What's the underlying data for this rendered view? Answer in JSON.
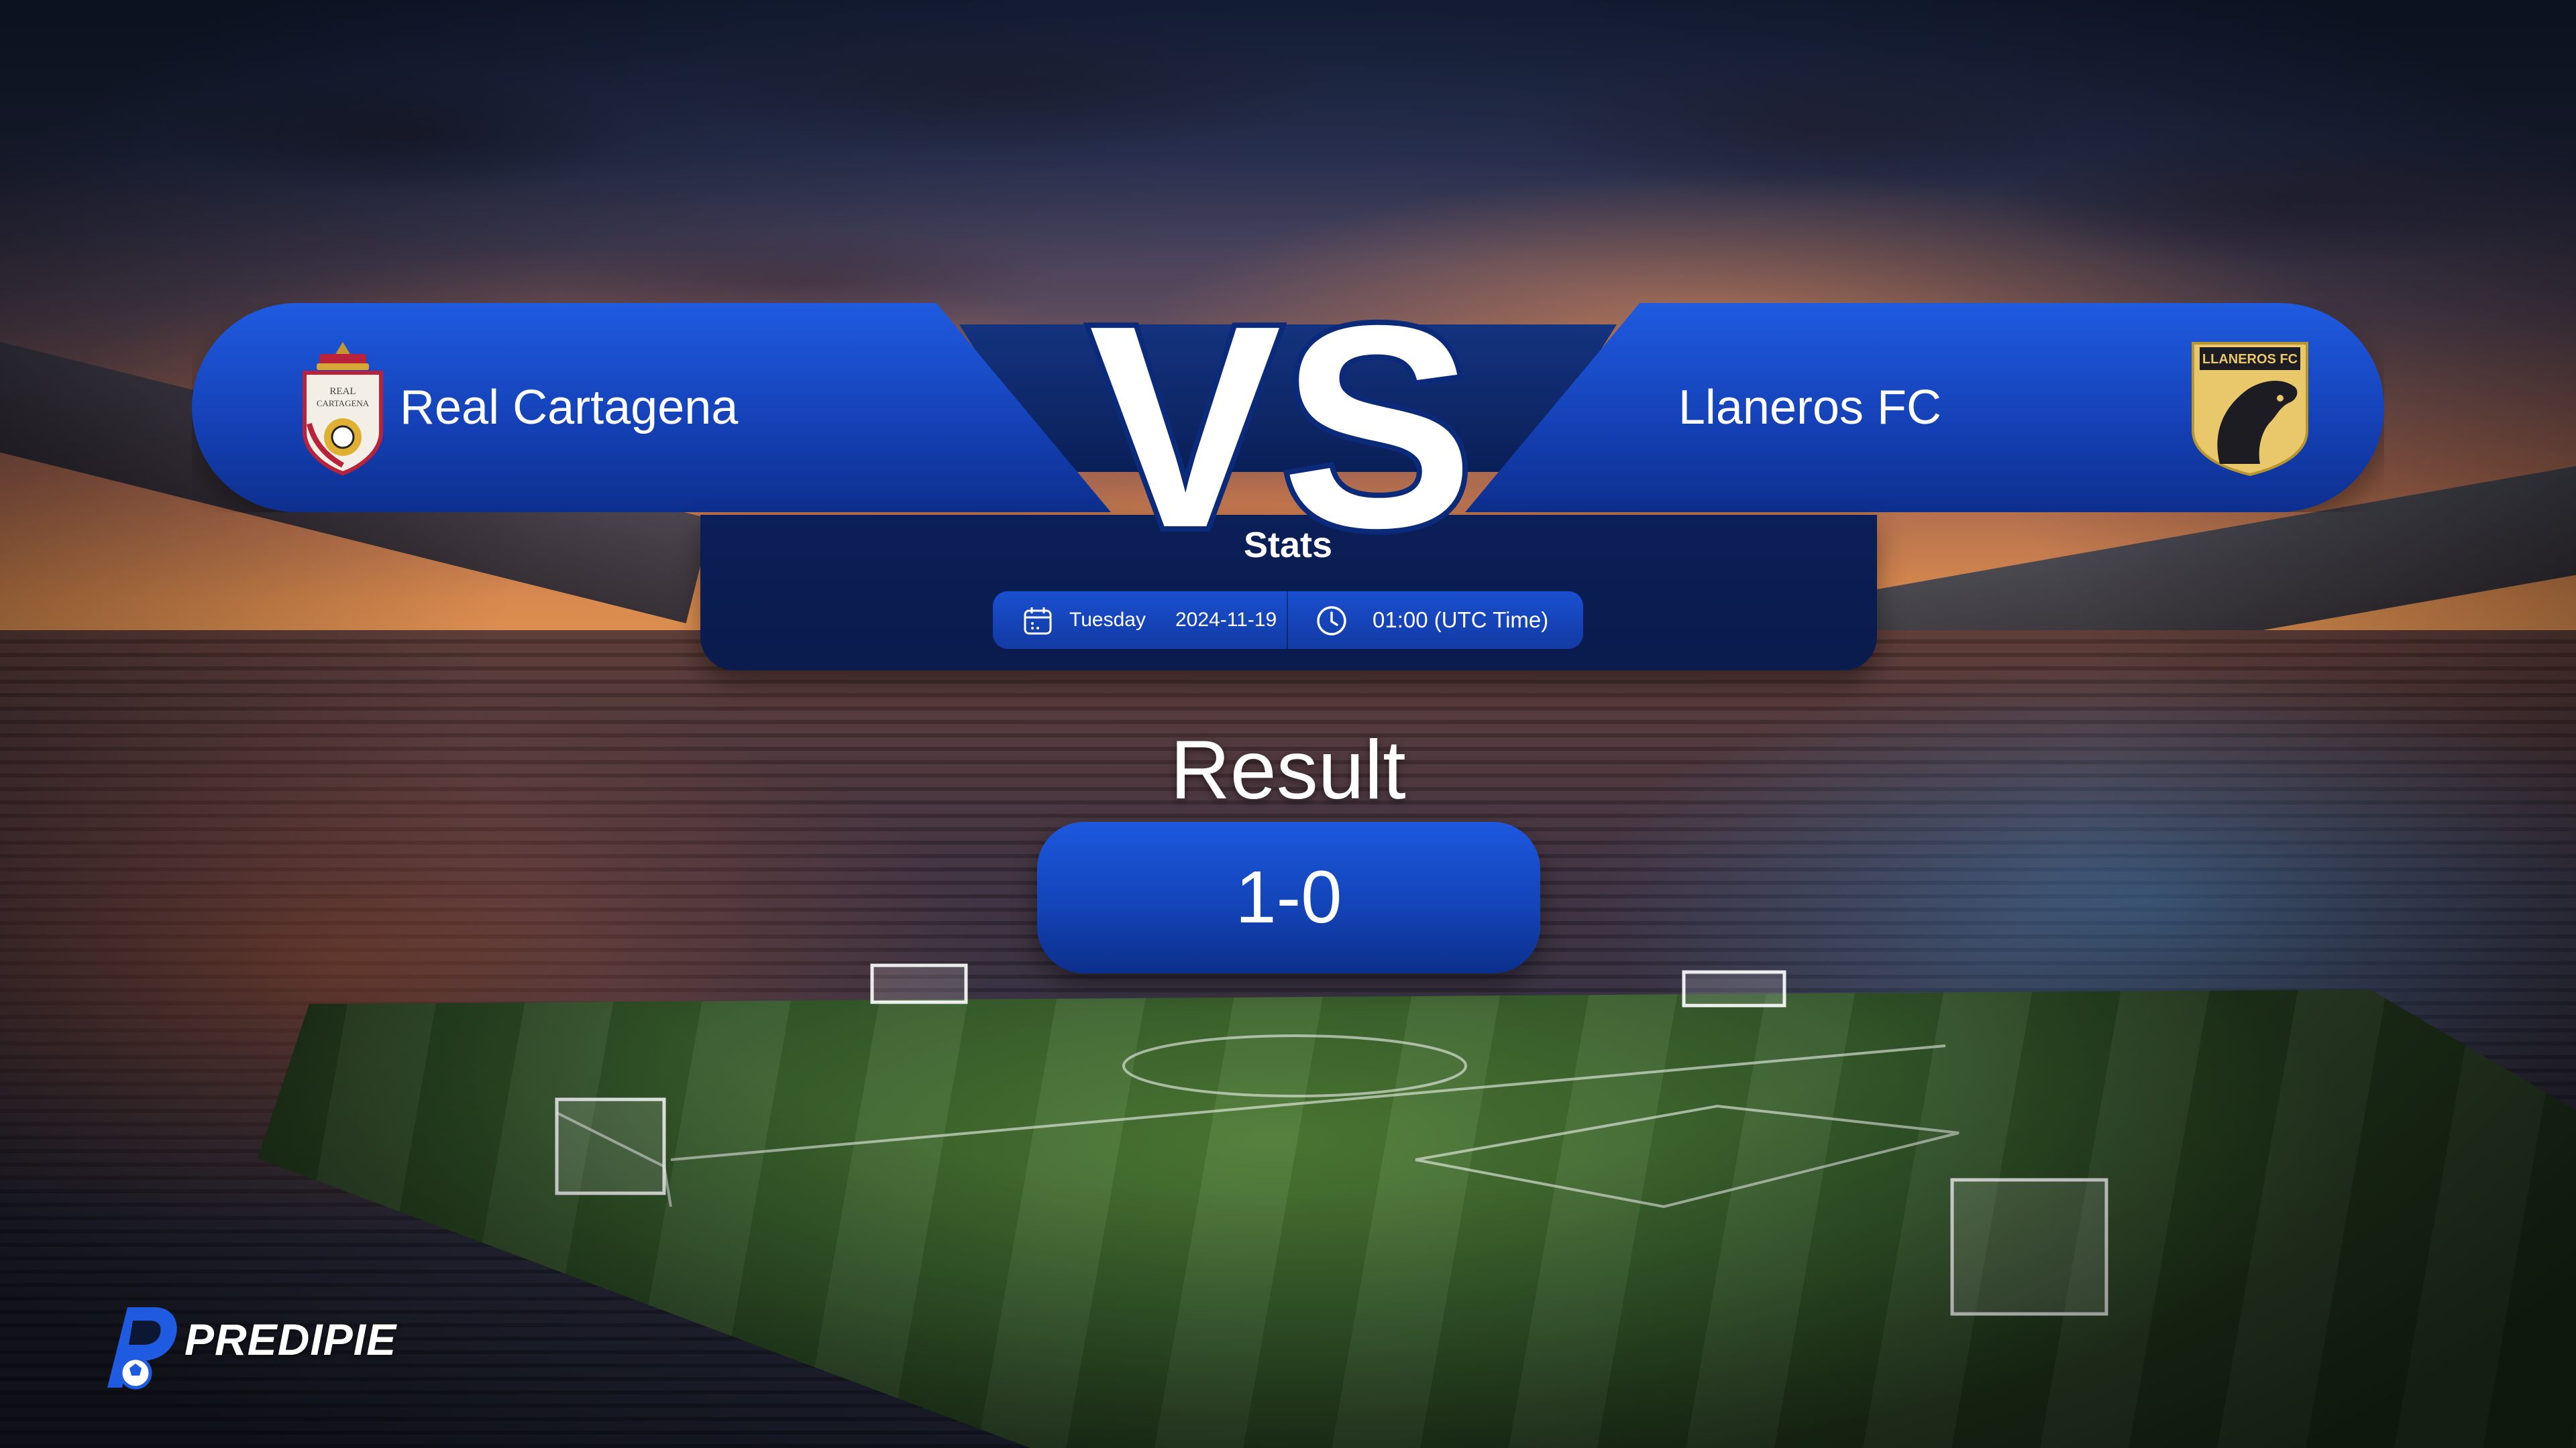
{
  "match": {
    "home_team": {
      "name": "Real Cartagena",
      "logo_icon": "real-cartagena-crest-icon",
      "logo_text": "REAL CARTAGENA"
    },
    "away_team": {
      "name": "Llaneros FC",
      "logo_icon": "llaneros-fc-crest-icon",
      "logo_text": "LLANEROS FC"
    },
    "vs_label": "VS",
    "stats_label": "Stats",
    "day": "Tuesday",
    "date": "2024-11-19",
    "time": "01:00 (UTC Time)",
    "result_label": "Result",
    "score": "1-0"
  },
  "brand": {
    "name": "PREDIPIE",
    "icon": "predipie-logo-icon"
  },
  "icons": {
    "calendar": "calendar-icon",
    "clock": "clock-icon"
  },
  "colors": {
    "banner_blue": "#1f5be0",
    "panel_navy": "#0b1f58",
    "text": "#ffffff"
  }
}
